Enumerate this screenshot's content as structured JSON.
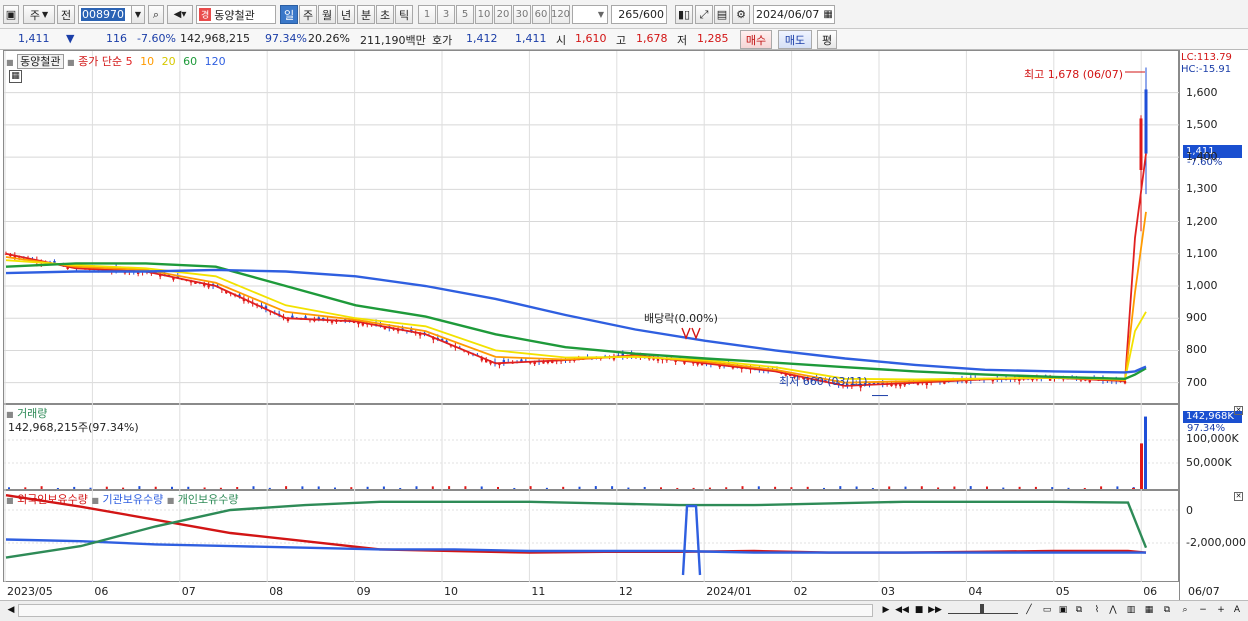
{
  "toolbar": {
    "type_label": "주",
    "prev_label": "전",
    "stock_code": "008970",
    "stock_badge": "경",
    "stock_name": "동양철관",
    "periods": [
      "일",
      "주",
      "월",
      "년",
      "분",
      "초",
      "틱"
    ],
    "active_period": "일",
    "intervals": [
      "1",
      "3",
      "5",
      "10",
      "20",
      "30",
      "60",
      "120"
    ],
    "count": "265",
    "count_max": "/600",
    "date": "2024/06/07"
  },
  "quote": {
    "price": "1,411",
    "change_arrow": "▼",
    "change": "116",
    "change_pct": "-7.60%",
    "volume": "142,968,215",
    "vol_ratio": "97.34%",
    "turnover_pct": "20.26%",
    "trade_value": "211,190백만",
    "bid_label": "호가",
    "bid": "1,412",
    "ask": "1,411",
    "open_label": "시",
    "open": "1,610",
    "high_label": "고",
    "high": "1,678",
    "low_label": "저",
    "low": "1,285",
    "buy_label": "매수",
    "sell_label": "매도",
    "avg_label": "평"
  },
  "price_panel": {
    "tab_name": "동양철관",
    "legend_close": "종가 단순",
    "ma_labels": [
      "5",
      "10",
      "20",
      "60",
      "120"
    ],
    "ma_colors": [
      "#e02020",
      "#ff9a00",
      "#f2e200",
      "#1e9a3a",
      "#2f5fe0"
    ],
    "lc": "LC:113.79",
    "hc": "HC:-15.91",
    "high_marker": "최고 1,678 (06/07)",
    "low_marker": "최저 660 (03/11)",
    "dividend_marker": "배당락(0.00%)",
    "current_price_tag": "1,411",
    "current_change_tag": "-7.60%"
  },
  "volume_panel": {
    "title": "거래량",
    "value_text": "142,968,215주(97.34%)",
    "tag_value": "142,968K",
    "tag_pct": "97.34%"
  },
  "holdings_panel": {
    "series_labels": [
      "외국인보유수량",
      "기관보유수량",
      "개인보유수량"
    ],
    "series_colors": [
      "#d21515",
      "#2f5fe0",
      "#2e8b57"
    ]
  },
  "chart_data": [
    {
      "type": "candlestick",
      "title": "동양철관",
      "x": [
        "2023/05",
        "06",
        "07",
        "08",
        "09",
        "10",
        "11",
        "12",
        "2024/01",
        "02",
        "03",
        "04",
        "05",
        "06",
        "06/07"
      ],
      "ylim": [
        640,
        1720
      ],
      "yticks": [
        "700",
        "800",
        "900",
        "1,000",
        "1,100",
        "1,200",
        "1,300",
        "1,400",
        "1,500",
        "1,600"
      ],
      "annotations": {
        "high": 1678,
        "low": 660,
        "last": 1411
      },
      "series": [
        {
          "name": "5",
          "values": [
            1100,
            1055,
            1045,
            1000,
            900,
            890,
            850,
            760,
            770,
            785,
            760,
            735,
            690,
            700,
            710,
            715,
            705,
            1150,
            1411
          ]
        },
        {
          "name": "10",
          "values": [
            1090,
            1060,
            1050,
            1010,
            920,
            895,
            860,
            780,
            772,
            782,
            765,
            740,
            700,
            705,
            712,
            716,
            708,
            980,
            1230
          ]
        },
        {
          "name": "20",
          "values": [
            1080,
            1065,
            1055,
            1030,
            940,
            900,
            875,
            800,
            778,
            780,
            770,
            748,
            712,
            710,
            713,
            715,
            710,
            860,
            920
          ]
        },
        {
          "name": "60",
          "values": [
            1060,
            1070,
            1070,
            1060,
            1000,
            940,
            905,
            850,
            810,
            790,
            775,
            762,
            748,
            735,
            725,
            718,
            712,
            725,
            745
          ]
        },
        {
          "name": "120",
          "values": [
            1040,
            1045,
            1045,
            1050,
            1045,
            1030,
            1000,
            960,
            910,
            865,
            830,
            800,
            775,
            755,
            740,
            735,
            732,
            735,
            750
          ]
        }
      ]
    },
    {
      "type": "bar",
      "title": "거래량",
      "yticks": [
        "50,000K",
        "100,000K"
      ],
      "values_recent": [
        2000,
        90000,
        142968
      ]
    },
    {
      "type": "line",
      "title": "보유수량",
      "yticks": [
        "0",
        "-2,000,000"
      ],
      "series": [
        {
          "name": "외국인보유수량",
          "values": [
            0.9,
            0.2,
            -0.6,
            -1.4,
            -1.9,
            -2.4,
            -2.5,
            -2.6,
            -2.55,
            -2.55,
            -2.5,
            -2.6,
            -2.6,
            -2.55,
            -2.5,
            -2.5,
            -2.6
          ]
        },
        {
          "name": "기관보유수량",
          "values": [
            -1.8,
            -1.9,
            -2.1,
            -2.2,
            -2.3,
            -2.4,
            -2.4,
            -2.5,
            -2.5,
            -2.5,
            -2.6,
            -2.6,
            -2.6,
            -2.6,
            -2.6,
            -2.6,
            -2.6
          ]
        },
        {
          "name": "개인보유수량",
          "values": [
            -2.9,
            -2.2,
            -1.0,
            0.0,
            0.3,
            0.5,
            0.5,
            0.5,
            0.4,
            0.3,
            0.3,
            0.4,
            0.5,
            0.5,
            0.5,
            0.45,
            -2.3
          ]
        }
      ]
    }
  ]
}
